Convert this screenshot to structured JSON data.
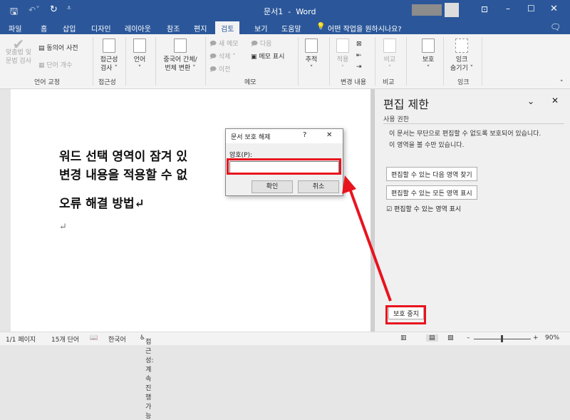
{
  "window": {
    "title": "문서1  -  Word",
    "controls": [
      "restore",
      "minimize",
      "maximize",
      "close"
    ]
  },
  "tabs": [
    "파일",
    "홈",
    "삽입",
    "디자인",
    "레이아웃",
    "참조",
    "편지",
    "검토",
    "보기",
    "도움말"
  ],
  "active_tab": "검토",
  "tell_me": "어떤 작업을 원하시나요?",
  "ribbon": {
    "spelling": "맞춤법 및\n문법 검사",
    "thesaurus": "동의어 사전",
    "word_count": "단어 개수",
    "group_proofing": "언어 교정",
    "accessibility": "접근성\n검사 ˅",
    "group_accessibility": "접근성",
    "language": "언어\n˅",
    "chinese": "중국어 간체/\n번체 변환 ˅",
    "new_comment": "새 메모",
    "delete": "삭제",
    "previous": "이전",
    "next": "다음",
    "show_comments": "메모 표시",
    "group_comments": "메모",
    "tracking": "추적\n˅",
    "accept": "적용\n˅",
    "group_changes": "변경 내용",
    "compare": "비교\n˅",
    "group_compare": "비교",
    "protect": "보호\n˅",
    "ink": "잉크\n숨기기 ˅",
    "group_ink": "잉크"
  },
  "document": {
    "line1": "워드 선택 영역이 잠겨 있",
    "line2": "변경 내용을 적용할 수 없",
    "line3": "오류 해결 방법↵",
    "line4": "↵"
  },
  "dialog": {
    "title": "문서 보호 해제",
    "help": "?",
    "close": "✕",
    "password_label": "암호(P):",
    "password_value": "",
    "ok": "확인",
    "cancel": "취소"
  },
  "pane": {
    "title": "편집 제한",
    "section": "사용 권한",
    "desc1": "이 문서는 무단으로 편집할 수 없도록 보호되어 있습니다.",
    "desc2": "이 영역을 볼 수만 있습니다.",
    "find_next": "편집할 수 있는 다음 영역 찾기",
    "show_all": "편집할 수 있는 모든 영역 표시",
    "highlight_label": "편집할 수 있는 영역 표시",
    "highlight_checked": true,
    "stop": "보호 중지"
  },
  "status": {
    "page": "1/1 페이지",
    "words": "15개 단어",
    "language": "한국어",
    "accessibility": "접근성: 계속 진행 가능",
    "zoom": "90%",
    "zoom_percent": 90
  },
  "colors": {
    "brand": "#2b579a",
    "annotation": "#e8141e"
  }
}
